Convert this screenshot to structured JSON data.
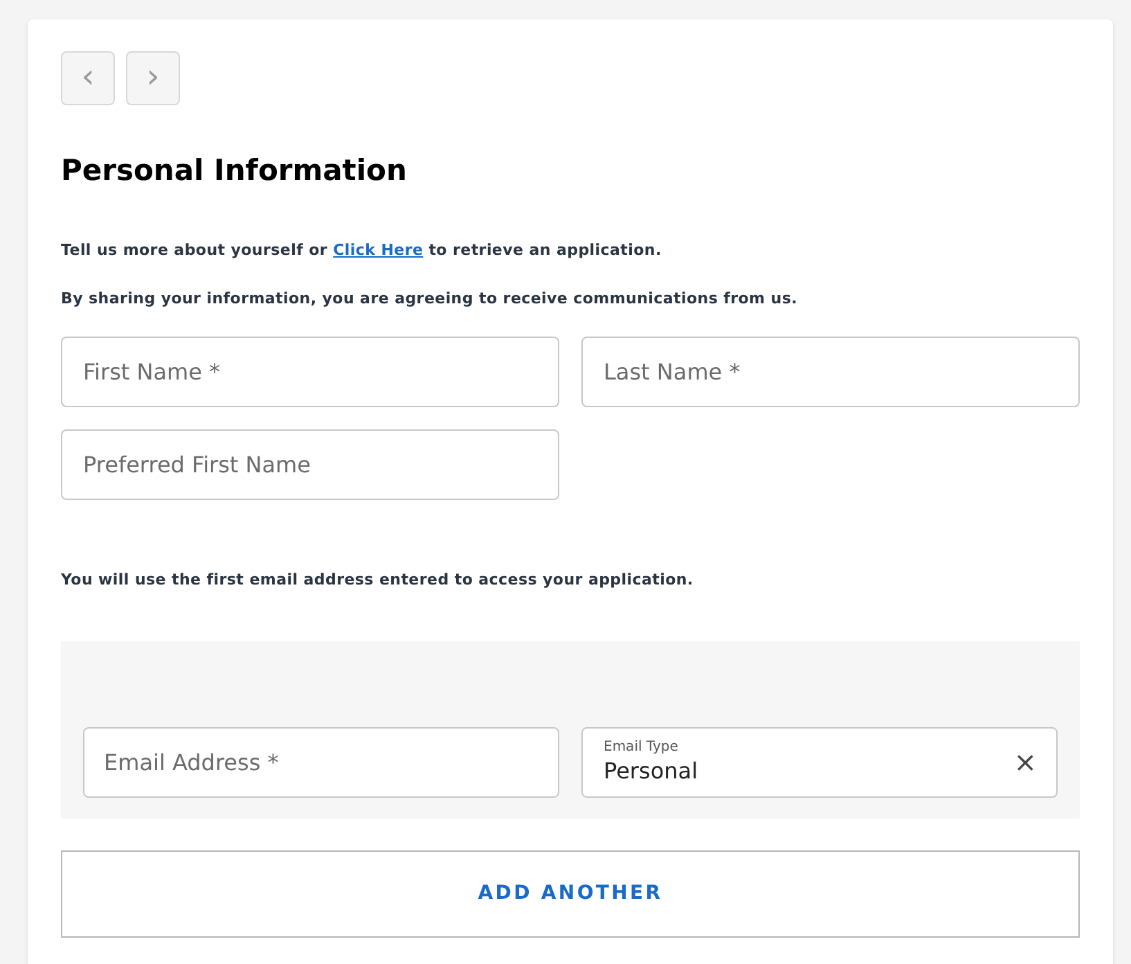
{
  "nav": {
    "back": "‹",
    "forward": "›"
  },
  "title": "Personal Information",
  "intro": {
    "before": "Tell us more about yourself or ",
    "link": "Click Here",
    "after": " to retrieve an application."
  },
  "consent": "By sharing your information, you are agreeing to receive communications from us.",
  "fields": [
    {
      "placeholder": "First Name *"
    },
    {
      "placeholder": "Last Name *"
    },
    {
      "placeholder": "Preferred First Name"
    }
  ],
  "email_note": "You will use the first email address entered to access your application.",
  "email": {
    "placeholder": "Email Address *",
    "type_label": "Email Type",
    "type_value": "Personal",
    "clear": "×"
  },
  "add_button": "ADD ANOTHER"
}
